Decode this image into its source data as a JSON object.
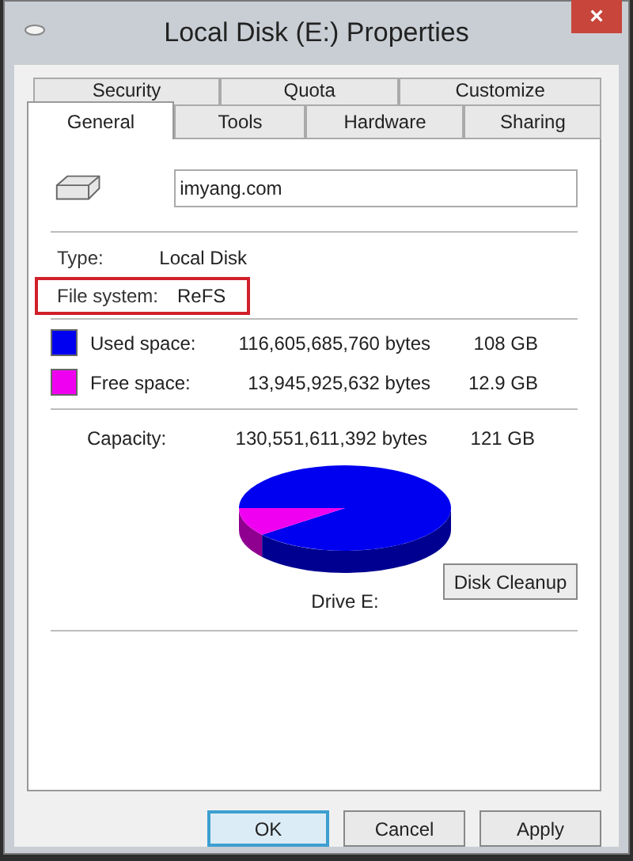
{
  "window": {
    "title": "Local Disk (E:) Properties",
    "close": "×"
  },
  "tabs": [
    [
      {
        "label": "Security",
        "selected": false
      },
      {
        "label": "Quota",
        "selected": false
      },
      {
        "label": "Customize",
        "selected": false
      }
    ],
    [
      {
        "label": "General",
        "selected": true
      },
      {
        "label": "Tools",
        "selected": false
      },
      {
        "label": "Hardware",
        "selected": false
      },
      {
        "label": "Sharing",
        "selected": false
      }
    ]
  ],
  "volume_name": "imyang.com",
  "info": [
    {
      "label": "Type:",
      "value": "Local Disk",
      "highlighted": false
    },
    {
      "label": "File system:",
      "value": "ReFS",
      "highlighted": true
    }
  ],
  "space": [
    {
      "label": "Used space:",
      "bytes": "116,605,685,760 bytes",
      "size": "108 GB",
      "color": "#0000f0"
    },
    {
      "label": "Free space:",
      "bytes": "13,945,925,632 bytes",
      "size": "12.9 GB",
      "color": "#f000f0"
    }
  ],
  "capacity": {
    "label": "Capacity:",
    "bytes": "130,551,611,392 bytes",
    "size": "121 GB"
  },
  "pie": {
    "title": "Drive E:"
  },
  "cleanup_button": "Disk Cleanup",
  "buttons": [
    {
      "label": "OK",
      "default": true
    },
    {
      "label": "Cancel",
      "default": false
    },
    {
      "label": "Apply",
      "default": false
    }
  ]
}
